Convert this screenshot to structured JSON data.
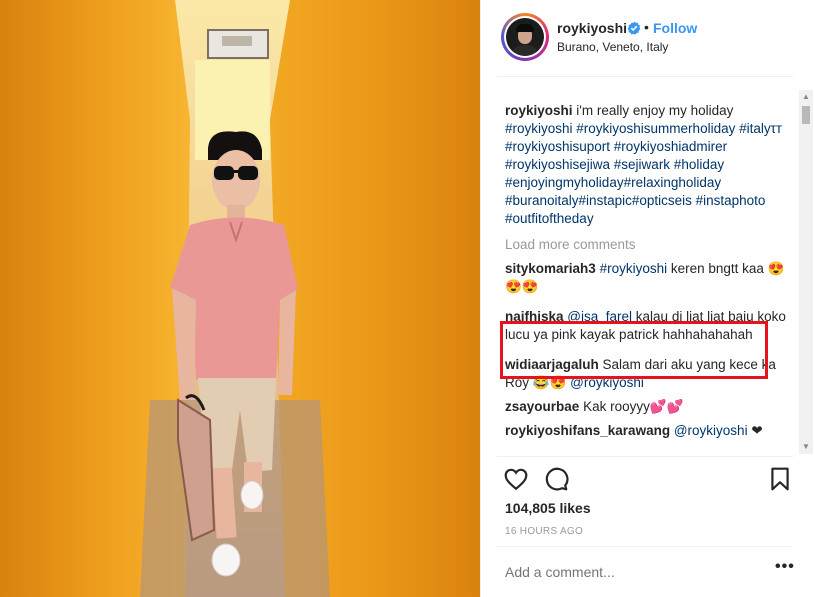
{
  "post": {
    "username": "roykiyoshi",
    "follow_label": "Follow",
    "separator_dot": "•",
    "location": "Burano, Veneto, Italy",
    "verified": true
  },
  "caption": {
    "user": "roykiyoshi",
    "text": "i'm really enjoy my holiday",
    "hashtags": "#roykiyoshi #roykiyoshisummerholiday #italyτт #roykiyoshisuport #roykiyoshiadmirer #roykiyoshisejiwa #sejiwark #holiday #enjoyingmyholiday#relaxingholiday #buranoitaly#instapic#opticseis #instaphoto #outfitoftheday"
  },
  "load_more": "Load more comments",
  "comments": [
    {
      "user": "sitykomariah3",
      "mention": "#roykiyoshi",
      "text": "keren bngtt kaa 😍😍😍"
    },
    {
      "user": "najfhiska",
      "mention": "@isa_farel",
      "text": "kalau di liat liat baju koko lucu ya pink kayak patrick hahhahahahah"
    },
    {
      "user": "widiaarjagaluh",
      "mention": "",
      "text": "Salam dari aku yang kece ka Roy 😂😍",
      "mention_after": "@roykiyoshi"
    },
    {
      "user": "zsayourbae",
      "mention": "",
      "text": "Kak rooyyy💕💕"
    },
    {
      "user": "roykiyoshifans_karawang",
      "mention": "@roykiyoshi",
      "text": "❤"
    }
  ],
  "likes": "104,805 likes",
  "time_ago": "16 HOURS AGO",
  "add_comment_placeholder": "Add a comment...",
  "more_label": "•••",
  "colors": {
    "link_blue": "#3897f0",
    "hashtag": "#003569",
    "highlight": "#e8121c",
    "wall_orange": "#e8951a"
  },
  "icons": [
    "verified-badge-icon",
    "heart-icon",
    "comment-icon",
    "bookmark-icon",
    "more-options-icon"
  ]
}
